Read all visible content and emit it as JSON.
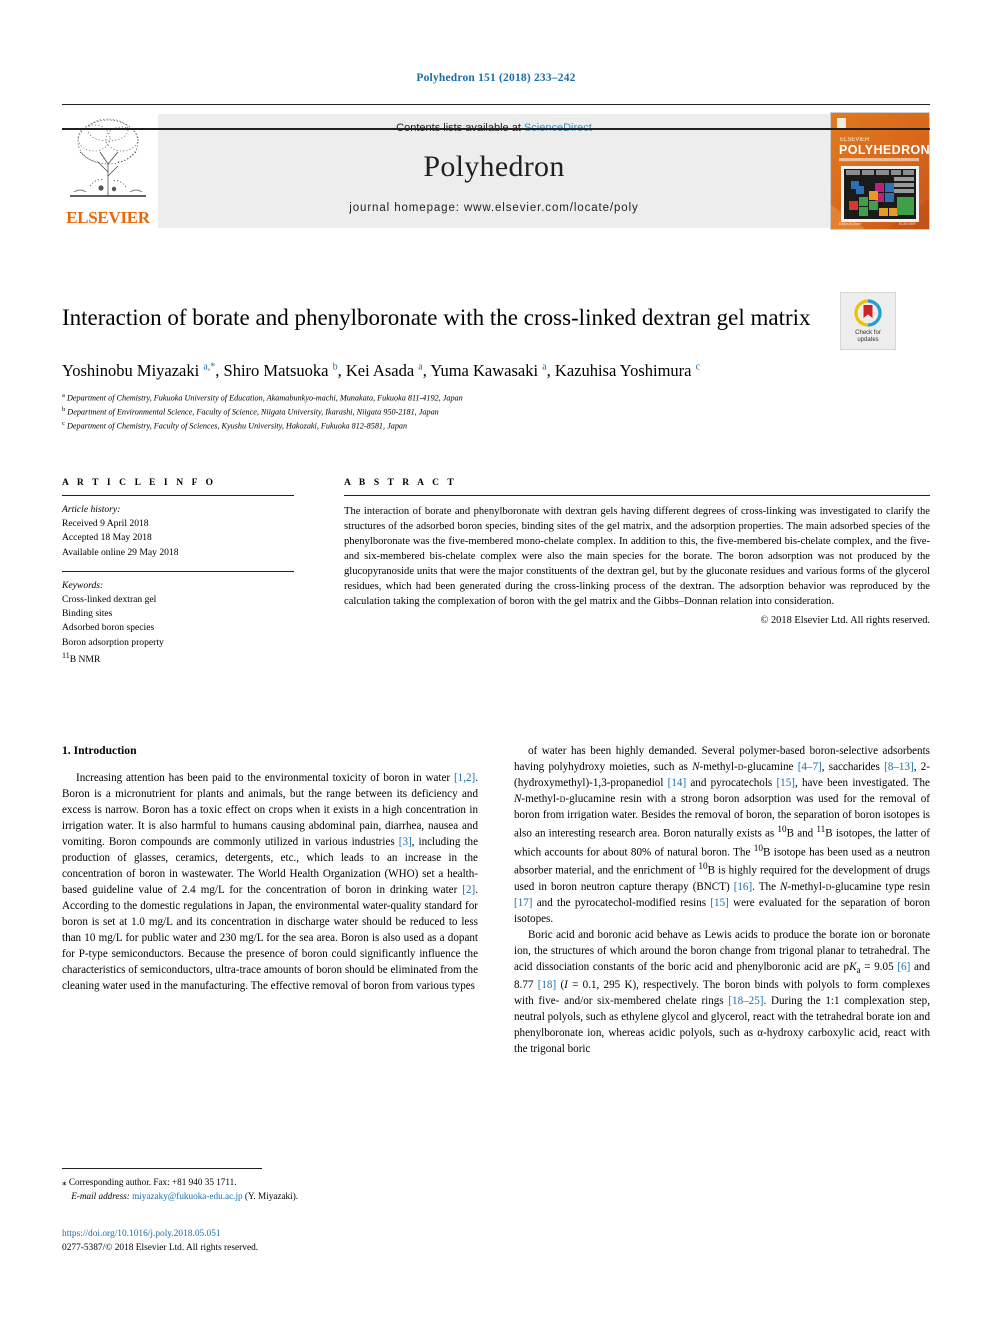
{
  "running_head": "Polyhedron 151 (2018) 233–242",
  "masthead": {
    "publisher": "ELSEVIER",
    "contents_prefix": "Contents lists available at ",
    "contents_link": "ScienceDirect",
    "journal_name": "Polyhedron",
    "homepage": "journal homepage: www.elsevier.com/locate/poly",
    "cover_title": "POLYHEDRON",
    "cover_subtitle": "INTERNATIONAL JOURNAL FOR INORGANIC CHEMISTRY"
  },
  "article": {
    "title": "Interaction of borate and phenylboronate with the cross-linked dextran gel matrix",
    "crossmark_line1": "Check for",
    "crossmark_line2": "updates",
    "authors_html": "Yoshinobu Miyazaki <sup>a,*</sup>, Shiro Matsuoka <sup>b</sup>, Kei Asada <sup>a</sup>, Yuma Kawasaki <sup>a</sup>, Kazuhisa Yoshimura <sup>c</sup>",
    "affiliations": [
      "Department of Chemistry, Fukuoka University of Education, Akamabunkyo-machi, Munakata, Fukuoka 811-4192, Japan",
      "Department of Environmental Science, Faculty of Science, Niigata University, Ikarashi, Niigata 950-2181, Japan",
      "Department of Chemistry, Faculty of Sciences, Kyushu University, Hakozaki, Fukuoka 812-8581, Japan"
    ],
    "affiliation_marks": [
      "a",
      "b",
      "c"
    ]
  },
  "info": {
    "heading": "A R T I C L E   I N F O",
    "history_label": "Article history:",
    "history": [
      "Received 9 April 2018",
      "Accepted 18 May 2018",
      "Available online 29 May 2018"
    ],
    "keywords_label": "Keywords:",
    "keywords": [
      "Cross-linked dextran gel",
      "Binding sites",
      "Adsorbed boron species",
      "Boron adsorption property"
    ],
    "keyword_nmr_sup": "11",
    "keyword_nmr_rest": "B NMR"
  },
  "abstract": {
    "heading": "A B S T R A C T",
    "text": "The interaction of borate and phenylboronate with dextran gels having different degrees of cross-linking was investigated to clarify the structures of the adsorbed boron species, binding sites of the gel matrix, and the adsorption properties. The main adsorbed species of the phenylboronate was the five-membered mono-chelate complex. In addition to this, the five-membered bis-chelate complex, and the five- and six-membered bis-chelate complex were also the main species for the borate. The boron adsorption was not produced by the glucopyranoside units that were the major constituents of the dextran gel, but by the gluconate residues and various forms of the glycerol residues, which had been generated during the cross-linking process of the dextran. The adsorption behavior was reproduced by the calculation taking the complexation of boron with the gel matrix and the Gibbs–Donnan relation into consideration.",
    "copyright": "© 2018 Elsevier Ltd. All rights reserved."
  },
  "body": {
    "section_heading": "1. Introduction",
    "left_paragraph_1_html": "Increasing attention has been paid to the environmental toxicity of boron in water <span class=\"ref\">[1,2]</span>. Boron is a micronutrient for plants and animals, but the range between its deficiency and excess is narrow. Boron has a toxic effect on crops when it exists in a high concentration in irrigation water. It is also harmful to humans causing abdominal pain, diarrhea, nausea and vomiting. Boron compounds are commonly utilized in various industries <span class=\"ref\">[3]</span>, including the production of glasses, ceramics, detergents, etc., which leads to an increase in the concentration of boron in wastewater. The World Health Organization (WHO) set a health-based guideline value of 2.4&nbsp;mg/L for the concentration of boron in drinking water <span class=\"ref\">[2]</span>. According to the domestic regulations in Japan, the environmental water-quality standard for boron is set at 1.0&nbsp;mg/L and its concentration in discharge water should be reduced to less than 10&nbsp;mg/L for public water and 230&nbsp;mg/L for the sea area. Boron is also used as a dopant for P-type semiconductors. Because the presence of boron could significantly influence the characteristics of semiconductors, ultra-trace amounts of boron should be eliminated from the cleaning water used in the manufacturing. The effective removal of boron from various types",
    "right_paragraph_1_html": "of water has been highly demanded. Several polymer-based boron-selective adsorbents having polyhydroxy moieties, such as <i>N</i>-methyl-<span class=\"sc\">d</span>-glucamine <span class=\"ref\">[4–7]</span>, saccharides <span class=\"ref\">[8–13]</span>, 2-(hydroxymethyl)-1,3-propanediol <span class=\"ref\">[14]</span> and pyrocatechols <span class=\"ref\">[15]</span>, have been investigated. The <i>N</i>-methyl-<span class=\"sc\">d</span>-glucamine resin with a strong boron adsorption was used for the removal of boron from irrigation water. Besides the removal of boron, the separation of boron isotopes is also an interesting research area. Boron naturally exists as <sup>10</sup>B and <sup>11</sup>B isotopes, the latter of which accounts for about 80% of natural boron. The <sup>10</sup>B isotope has been used as a neutron absorber material, and the enrichment of <sup>10</sup>B is highly required for the development of drugs used in boron neutron capture therapy (BNCT) <span class=\"ref\">[16]</span>. The <i>N</i>-methyl-<span class=\"sc\">d</span>-glucamine type resin <span class=\"ref\">[17]</span> and the pyrocatechol-modified resins <span class=\"ref\">[15]</span> were evaluated for the separation of boron isotopes.",
    "right_paragraph_2_html": "Boric acid and boronic acid behave as Lewis acids to produce the borate ion or boronate ion, the structures of which around the boron change from trigonal planar to tetrahedral. The acid dissociation constants of the boric acid and phenylboronic acid are p<i>K</i><sub>a</sub> = 9.05 <span class=\"ref\">[6]</span> and 8.77 <span class=\"ref\">[18]</span> (<i>I</i> = 0.1, 295 K), respectively. The boron binds with polyols to form complexes with five- and/or six-membered chelate rings <span class=\"ref\">[18–25]</span>. During the 1:1 complexation step, neutral polyols, such as ethylene glycol and glycerol, react with the tetrahedral borate ion and phenylboronate ion, whereas acidic polyols, such as α-hydroxy carboxylic acid, react with the trigonal boric"
  },
  "footnote": {
    "marker": "⁎",
    "corresponding": "Corresponding author. Fax: +81 940 35 1711.",
    "email_label": "E-mail address:",
    "email": "miyazaky@fukuoka-edu.ac.jp",
    "email_suffix": "(Y. Miyazaki)."
  },
  "footer": {
    "doi": "https://doi.org/10.1016/j.poly.2018.05.051",
    "issn_line": "0277-5387/© 2018 Elsevier Ltd. All rights reserved."
  },
  "colors": {
    "link": "#1a6ea8",
    "elsevier_orange": "#ec6608",
    "masthead_grey": "#ededed"
  }
}
